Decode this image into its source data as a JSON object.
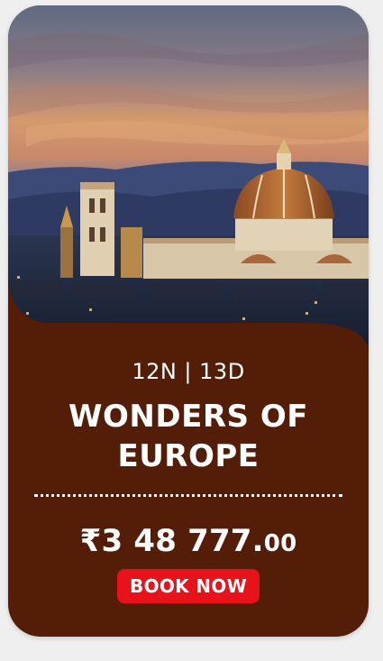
{
  "package": {
    "duration": "12N | 13D",
    "title": "Wonders of Europe",
    "price_main": "₹3 48 777.",
    "price_decimals": "00",
    "book_label": "BOOK NOW"
  },
  "colors": {
    "card_background": "#541d07",
    "button": "#e8121a",
    "page_background": "#efefef"
  },
  "image": {
    "subject": "florence-cathedral-dusk-photo"
  }
}
